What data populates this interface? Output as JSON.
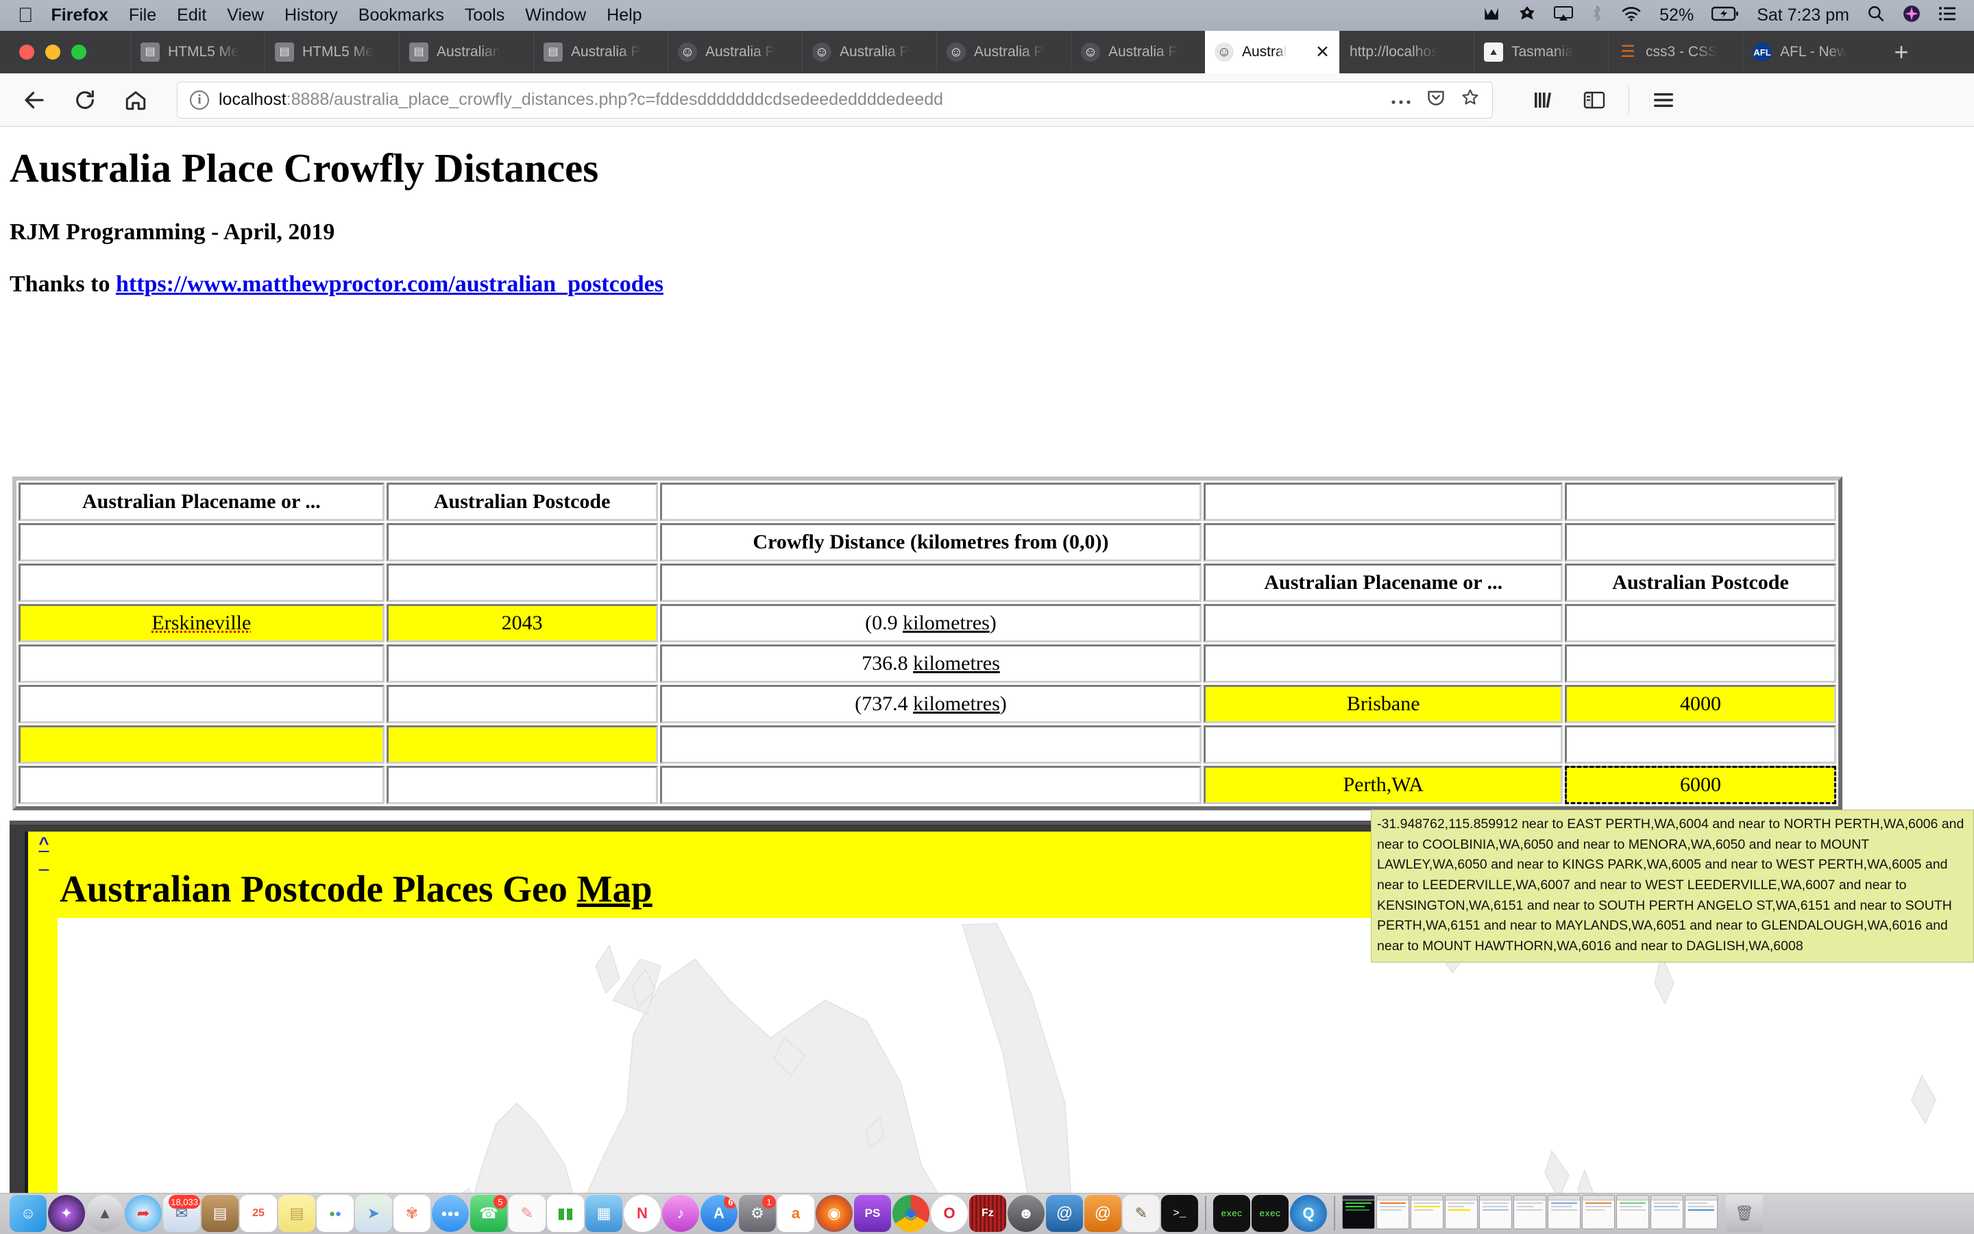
{
  "menubar": {
    "apple_icon": "apple-icon",
    "items": [
      {
        "label": "Firefox",
        "bold": true
      },
      {
        "label": "File",
        "bold": false
      },
      {
        "label": "Edit",
        "bold": false
      },
      {
        "label": "View",
        "bold": false
      },
      {
        "label": "History",
        "bold": false
      },
      {
        "label": "Bookmarks",
        "bold": false
      },
      {
        "label": "Tools",
        "bold": false
      },
      {
        "label": "Window",
        "bold": false
      },
      {
        "label": "Help",
        "bold": false
      }
    ],
    "status_icons": [
      "malwarebytes-icon",
      "avast-icon",
      "airplay-icon",
      "bluetooth-icon",
      "wifi-icon"
    ],
    "battery": "52%",
    "battery_icon": "battery-charging-icon",
    "clock": "Sat 7:23 pm",
    "search_icon": "search-icon",
    "siri_icon": "siri-icon",
    "notification_icon": "notification-center-icon"
  },
  "browser": {
    "tabs": [
      {
        "label": "HTML5 Me",
        "favicon": "doc-icon",
        "active": false
      },
      {
        "label": "HTML5 Me",
        "favicon": "doc-icon",
        "active": false
      },
      {
        "label": "Australian",
        "favicon": "doc-icon",
        "active": false
      },
      {
        "label": "Australia P",
        "favicon": "doc-icon",
        "active": false
      },
      {
        "label": "Australia P",
        "favicon": "koala-icon",
        "active": false
      },
      {
        "label": "Australia P",
        "favicon": "koala-icon",
        "active": false
      },
      {
        "label": "Australia P",
        "favicon": "koala-icon",
        "active": false
      },
      {
        "label": "Australia P",
        "favicon": "koala-icon",
        "active": false
      },
      {
        "label": "Austral",
        "favicon": "koala-icon",
        "active": true,
        "close_icon": "close-icon"
      },
      {
        "label": "http://localhos",
        "favicon": "none",
        "active": false
      },
      {
        "label": "Tasmania",
        "favicon": "tasmania-icon",
        "active": false
      },
      {
        "label": "css3 - CSS",
        "favicon": "css3-icon",
        "active": false
      },
      {
        "label": "AFL - New",
        "favicon": "afl-icon",
        "active": false
      }
    ],
    "new_tab_label": "+",
    "nav": {
      "back_icon": "back-arrow-icon",
      "forward_icon": "forward-arrow-icon",
      "reload_icon": "reload-icon",
      "home_icon": "home-icon",
      "info_icon": "info-icon",
      "url_host": "localhost",
      "url_rest": ":8888/australia_place_crowfly_distances.php?c=fddesdddddddcdsedeededdddedeedd",
      "more_icon": "ellipsis-icon",
      "pocket_icon": "pocket-icon",
      "bookmark_icon": "star-icon",
      "library_icon": "library-icon",
      "sidebar_icon": "sidebar-icon",
      "menu_icon": "hamburger-menu-icon"
    }
  },
  "page": {
    "title": "Australia Place Crowfly Distances",
    "subtitle": "RJM Programming - April, 2019",
    "thanks_prefix": "Thanks to ",
    "thanks_link": "https://www.matthewproctor.com/australian_postcodes",
    "table": {
      "headers": {
        "placename": "Australian Placename or ...",
        "postcode": "Australian Postcode",
        "distance": "Crowfly Distance (kilometres from (0,0))"
      },
      "rows": [
        {
          "c1": "",
          "c2": "",
          "c3": "",
          "c4": "",
          "c5": "",
          "c1_hdr": true,
          "c2_hdr": true,
          "c1_text": "Australian Placename or ...",
          "c2_text": "Australian Postcode"
        },
        {
          "c3_text": "Crowfly Distance (kilometres from (0,0))"
        },
        {
          "c4_text": "Australian Placename or ...",
          "c5_text": "Australian Postcode"
        },
        {
          "c1_text": "Erskineville",
          "c2_text": "2043",
          "c3_text": "(0.9 kilometres)",
          "c4_text": "",
          "c5_text": ""
        },
        {
          "c1_text": "",
          "c2_text": "",
          "c3_text": "736.8 kilometres",
          "c4_text": "",
          "c5_text": ""
        },
        {
          "c1_text": "",
          "c2_text": "",
          "c3_text": "(737.4 kilometres)",
          "c4_text": "Brisbane",
          "c5_text": "4000"
        },
        {
          "c1_text": "",
          "c2_text": "",
          "c3_text": "",
          "c4_text": "",
          "c5_text": ""
        },
        {
          "c1_text": "",
          "c2_text": "",
          "c3_text": "",
          "c4_text": "Perth,WA",
          "c5_text": "6000"
        }
      ],
      "distance_unit_word": "kilometres"
    },
    "map": {
      "anchor_up": "^",
      "anchor_down": "_",
      "heading_plain": "Australian Postcode Places Geo ",
      "heading_underlined": "Map"
    },
    "tooltip": "-31.948762,115.859912 near to EAST PERTH,WA,6004 and near to NORTH PERTH,WA,6006 and near to COOLBINIA,WA,6050 and near to MENORA,WA,6050 and near to MOUNT LAWLEY,WA,6050 and near to KINGS PARK,WA,6005 and near to WEST PERTH,WA,6005 and near to LEEDERVILLE,WA,6007 and near to WEST LEEDERVILLE,WA,6007 and near to KENSINGTON,WA,6151 and near to SOUTH PERTH ANGELO ST,WA,6151 and near to SOUTH PERTH,WA,6151 and near to MAYLANDS,WA,6051 and near to GLENDALOUGH,WA,6016 and near to MOUNT HAWTHORN,WA,6016 and near to DAGLISH,WA,6008"
  },
  "colors": {
    "highlight": "#ffff00",
    "link": "#0000ee",
    "tooltip_bg": "#e6eda0",
    "chrome_dark": "#3b3b3d"
  },
  "dock": {
    "items": [
      {
        "name": "finder-icon",
        "bg": "#1e8fe1",
        "glyph": "☺",
        "badge": null,
        "running": true
      },
      {
        "name": "siri-icon",
        "bg": "#1b1133",
        "glyph": "✦",
        "badge": null,
        "running": false
      },
      {
        "name": "launchpad-icon",
        "bg": "#9a9aa0",
        "glyph": "🚀",
        "badge": null,
        "running": false
      },
      {
        "name": "safari-icon",
        "bg": "#2f9fe8",
        "glyph": "◎",
        "badge": null,
        "running": true
      },
      {
        "name": "mail-icon",
        "bg": "#dfe4ea",
        "glyph": "✉",
        "badge": "18,033",
        "running": false
      },
      {
        "name": "contacts-icon",
        "bg": "#b08a52",
        "glyph": "▤",
        "badge": null,
        "running": false
      },
      {
        "name": "calendar-icon",
        "bg": "#ffffff",
        "glyph": "25",
        "badge": null,
        "running": false
      },
      {
        "name": "notes-icon",
        "bg": "#f7e98a",
        "glyph": "▤",
        "badge": null,
        "running": false
      },
      {
        "name": "reminders-icon",
        "bg": "#ffffff",
        "glyph": "●",
        "badge": null,
        "running": false
      },
      {
        "name": "maps-icon",
        "bg": "#eef1f3",
        "glyph": "➤",
        "badge": null,
        "running": false
      },
      {
        "name": "photos-icon",
        "bg": "#ffffff",
        "glyph": "✾",
        "badge": null,
        "running": false
      },
      {
        "name": "messages-icon",
        "bg": "#3aa3f5",
        "glyph": "●●●",
        "badge": null,
        "running": true
      },
      {
        "name": "facetime-icon",
        "bg": "#35c759",
        "glyph": "📞",
        "badge": "5",
        "running": false
      },
      {
        "name": "pages-icon",
        "bg": "#f2f2f2",
        "glyph": "✎",
        "badge": null,
        "running": true
      },
      {
        "name": "numbers-icon",
        "bg": "#ffffff",
        "glyph": "▮▮",
        "badge": null,
        "running": false
      },
      {
        "name": "keynote-icon",
        "bg": "#4fa8e8",
        "glyph": "▦",
        "badge": null,
        "running": false
      },
      {
        "name": "news-icon",
        "bg": "#f5334f",
        "glyph": "N",
        "badge": null,
        "running": false
      },
      {
        "name": "itunes-icon",
        "bg": "#e05fd8",
        "glyph": "♪",
        "badge": null,
        "running": true
      },
      {
        "name": "appstore-icon",
        "bg": "#1f8ff0",
        "glyph": "A",
        "badge": "6",
        "running": false
      },
      {
        "name": "system-preferences-icon",
        "bg": "#7c7c82",
        "glyph": "⚙",
        "badge": "1",
        "running": false
      },
      {
        "name": "avast-icon",
        "bg": "#ffffff",
        "glyph": "a",
        "badge": null,
        "running": true
      },
      {
        "name": "firefox-icon",
        "bg": "#ffffff",
        "glyph": "◉",
        "badge": null,
        "running": true
      },
      {
        "name": "phpstorm-icon",
        "bg": "#8b3ddb",
        "glyph": "PS",
        "badge": null,
        "running": false
      },
      {
        "name": "chrome-icon",
        "bg": "#ffffff",
        "glyph": "◉",
        "badge": null,
        "running": true
      },
      {
        "name": "opera-icon",
        "bg": "#ffffff",
        "glyph": "O",
        "badge": null,
        "running": true
      },
      {
        "name": "filezilla-icon",
        "bg": "#b22222",
        "glyph": "Fz",
        "badge": null,
        "running": true
      },
      {
        "name": "koala-icon",
        "bg": "#5b5b60",
        "glyph": "☻",
        "badge": null,
        "running": true
      },
      {
        "name": "mamp-icon",
        "bg": "#2a6fb5",
        "glyph": "@",
        "badge": null,
        "running": true
      },
      {
        "name": "mamp-pro-icon",
        "bg": "#e8801a",
        "glyph": "@",
        "badge": null,
        "running": true
      },
      {
        "name": "gimp-icon",
        "bg": "#f2f2f2",
        "glyph": "✎",
        "badge": null,
        "running": false
      },
      {
        "name": "terminal-icon",
        "bg": "#111111",
        "glyph": ">_",
        "badge": null,
        "running": true
      },
      {
        "name": "exec-icon-1",
        "bg": "#111111",
        "glyph": "exec",
        "badge": null,
        "running": false
      },
      {
        "name": "exec-icon-2",
        "bg": "#111111",
        "glyph": "exec",
        "badge": null,
        "running": false
      },
      {
        "name": "quicktime-icon",
        "bg": "#1d7fd4",
        "glyph": "Q",
        "badge": null,
        "running": true
      }
    ],
    "minimized_windows": 11,
    "trash_icon": "trash-icon"
  }
}
